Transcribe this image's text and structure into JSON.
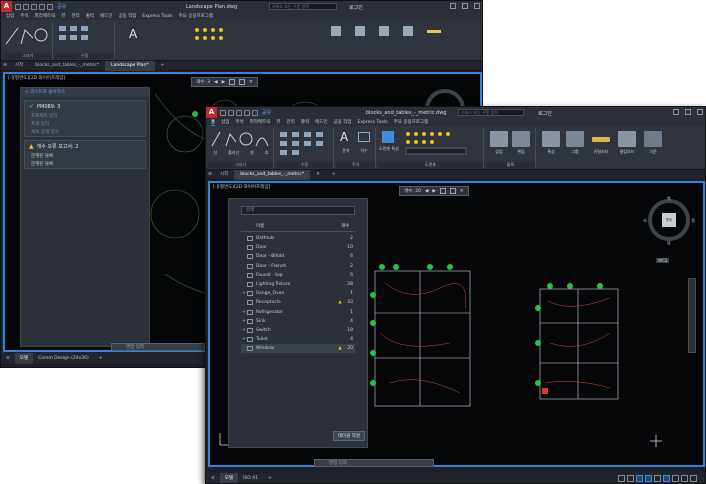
{
  "back_window": {
    "title": "Landscape Plan.dwg",
    "search_placeholder": "키워드 또는 구문 입력",
    "user": "로그인",
    "share": "공유",
    "menu": [
      "삽입",
      "주석",
      "파라메트릭",
      "뷰",
      "관리",
      "출력",
      "애드인",
      "공동 작업",
      "Express Tools",
      "주요 응용프로그램"
    ],
    "ribbon_groups": [
      "그리기",
      "수정"
    ],
    "tabs": {
      "start": "시작",
      "doc1": "blocks_and_tables_-_metric*",
      "doc2": "Landscape Plan*"
    },
    "view_label": "[-][평면도][2D 와이어프레임]",
    "nav_count": "개수: 3",
    "panel": {
      "back": "< 리스트로 돌아가기",
      "group1": {
        "title": "PM089: 3",
        "items": [
          "프로젝트 일치",
          "폭괴 일치",
          "새로 상태 일치"
        ]
      },
      "group2": {
        "title": "개수 오류 보고서: 2",
        "items": [
          "분해된 블록",
          "분해된 블록"
        ]
      }
    },
    "status": {
      "model": "모델",
      "layout": "Comm Design (24x36)"
    },
    "command_placeholder": "명령 입력"
  },
  "front_window": {
    "title": "blocks_and_tables_-_metric.dwg",
    "search_placeholder": "키워드 또는 구문 입력",
    "user": "로그인",
    "share": "공유",
    "menu": [
      "홈",
      "삽입",
      "주석",
      "파라메트릭",
      "뷰",
      "관리",
      "출력",
      "애드인",
      "공동 작업",
      "Express Tools",
      "주요 응용프로그램"
    ],
    "ribbon": {
      "draw_tools": [
        "선",
        "폴리선",
        "원",
        "호"
      ],
      "text_label": "문자",
      "dim_label": "치수",
      "layer_label": "도면층 특성",
      "groups": [
        "그리기",
        "수정",
        "주석",
        "도면층",
        "블록"
      ],
      "right_buttons": [
        "삽입",
        "편집",
        "특성",
        "그룹",
        "유틸리티",
        "클립보드",
        "기준"
      ]
    },
    "tabs": {
      "start": "시작",
      "doc": "blocks_and_tables_-_metric*"
    },
    "view_label": "[-][평면도][2D 와이어프레임]",
    "nav_count": "개수: 20",
    "block_panel": {
      "search_placeholder": "검색",
      "col_name": "이름",
      "col_count": "개수",
      "rows": [
        {
          "expand": "",
          "name": "Bathtub",
          "warn": false,
          "count": "2"
        },
        {
          "expand": "",
          "name": "Door",
          "warn": false,
          "count": "10"
        },
        {
          "expand": "",
          "name": "Door - Bifold",
          "warn": false,
          "count": "6"
        },
        {
          "expand": "",
          "name": "Door - French",
          "warn": false,
          "count": "2"
        },
        {
          "expand": "",
          "name": "Faucet - top",
          "warn": false,
          "count": "6"
        },
        {
          "expand": "",
          "name": "Lighting fixture",
          "warn": false,
          "count": "28"
        },
        {
          "expand": "+",
          "name": "Range_Oven",
          "warn": false,
          "count": "1"
        },
        {
          "expand": "",
          "name": "Receptacle",
          "warn": true,
          "count": "43"
        },
        {
          "expand": "+",
          "name": "Refrigerator",
          "warn": false,
          "count": "1"
        },
        {
          "expand": "+",
          "name": "Sink",
          "warn": false,
          "count": "4"
        },
        {
          "expand": "+",
          "name": "Switch",
          "warn": false,
          "count": "19"
        },
        {
          "expand": "+",
          "name": "Toilet",
          "warn": false,
          "count": "4"
        },
        {
          "expand": "",
          "name": "Window",
          "warn": true,
          "count": "20"
        }
      ],
      "create_table_button": "테이블 작성"
    },
    "viewcube": {
      "top": "북",
      "west": "서",
      "east": "동",
      "south": "남",
      "face": "맨위",
      "wcs": "WCS"
    },
    "status": {
      "model": "모델",
      "layout": "ISO A1"
    },
    "command_placeholder": "명령 입력"
  },
  "colors": {
    "accent": "#2f86d8",
    "brand": "#c3282e",
    "warning": "#f0c020",
    "ok": "#2fb35a",
    "fixture_green": "#28c24a",
    "fixture_red": "#e23a2a"
  }
}
